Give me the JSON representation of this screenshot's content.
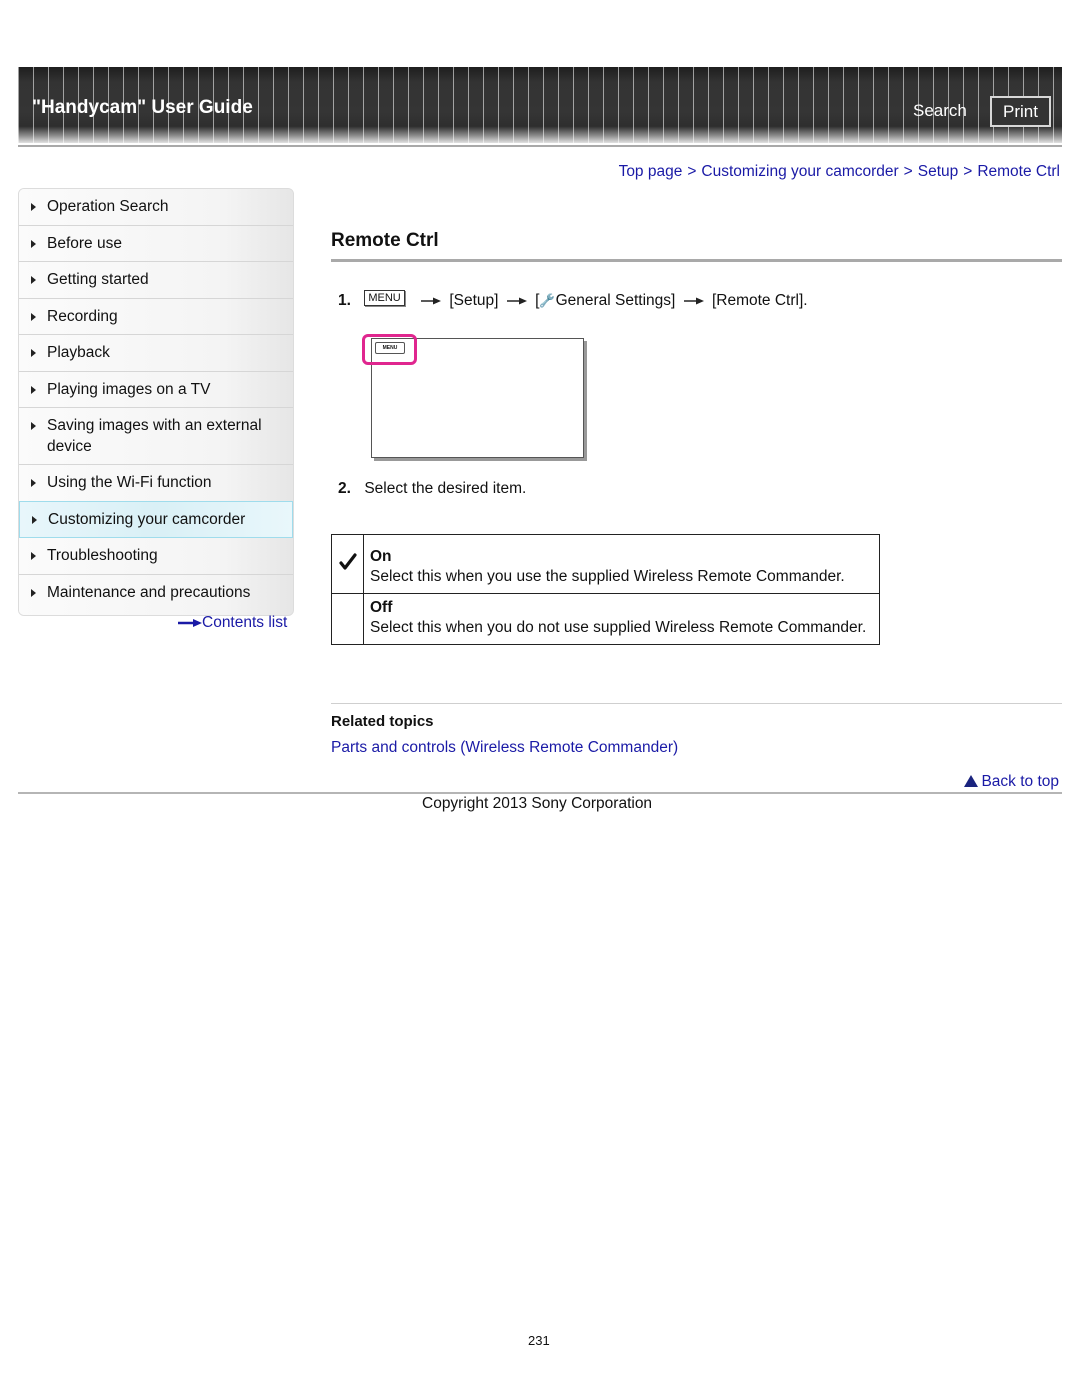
{
  "header": {
    "title": "\"Handycam\" User Guide",
    "search_label": "Search",
    "print_label": "Print"
  },
  "breadcrumb": {
    "items": [
      "Top page",
      "Customizing your camcorder",
      "Setup",
      "Remote Ctrl"
    ],
    "separator": ">"
  },
  "sidebar": {
    "items": [
      {
        "label": "Operation Search"
      },
      {
        "label": "Before use"
      },
      {
        "label": "Getting started"
      },
      {
        "label": "Recording"
      },
      {
        "label": "Playback"
      },
      {
        "label": "Playing images on a TV"
      },
      {
        "label": "Saving images with an external device"
      },
      {
        "label": "Using the Wi-Fi function"
      },
      {
        "label": "Customizing your camcorder",
        "active": true
      },
      {
        "label": "Troubleshooting"
      },
      {
        "label": "Maintenance and precautions"
      }
    ],
    "contents_list_label": "Contents list"
  },
  "main": {
    "title": "Remote Ctrl",
    "step1": {
      "number": "1.",
      "menu_key": "MENU",
      "setup": "[Setup]",
      "general_settings_open": "[",
      "general_settings": "General Settings]",
      "remote_ctrl": "[Remote Ctrl]."
    },
    "screen_menu_label": "MENU",
    "step2": {
      "number": "2.",
      "text": "Select the desired item."
    },
    "options": [
      {
        "name": "On",
        "description": "Select this when you use the supplied Wireless Remote Commander.",
        "default": true
      },
      {
        "name": "Off",
        "description": "Select this when you do not use supplied Wireless Remote Commander.",
        "default": false
      }
    ],
    "related": {
      "title": "Related topics",
      "links": [
        "Parts and controls (Wireless Remote Commander)"
      ]
    },
    "back_to_top": "Back to top"
  },
  "footer": {
    "copyright": "Copyright 2013 Sony Corporation",
    "page_number": "231"
  },
  "colors": {
    "link": "#1a1aa6",
    "highlight": "#e0268f",
    "active_nav": "#d9f0f6"
  }
}
